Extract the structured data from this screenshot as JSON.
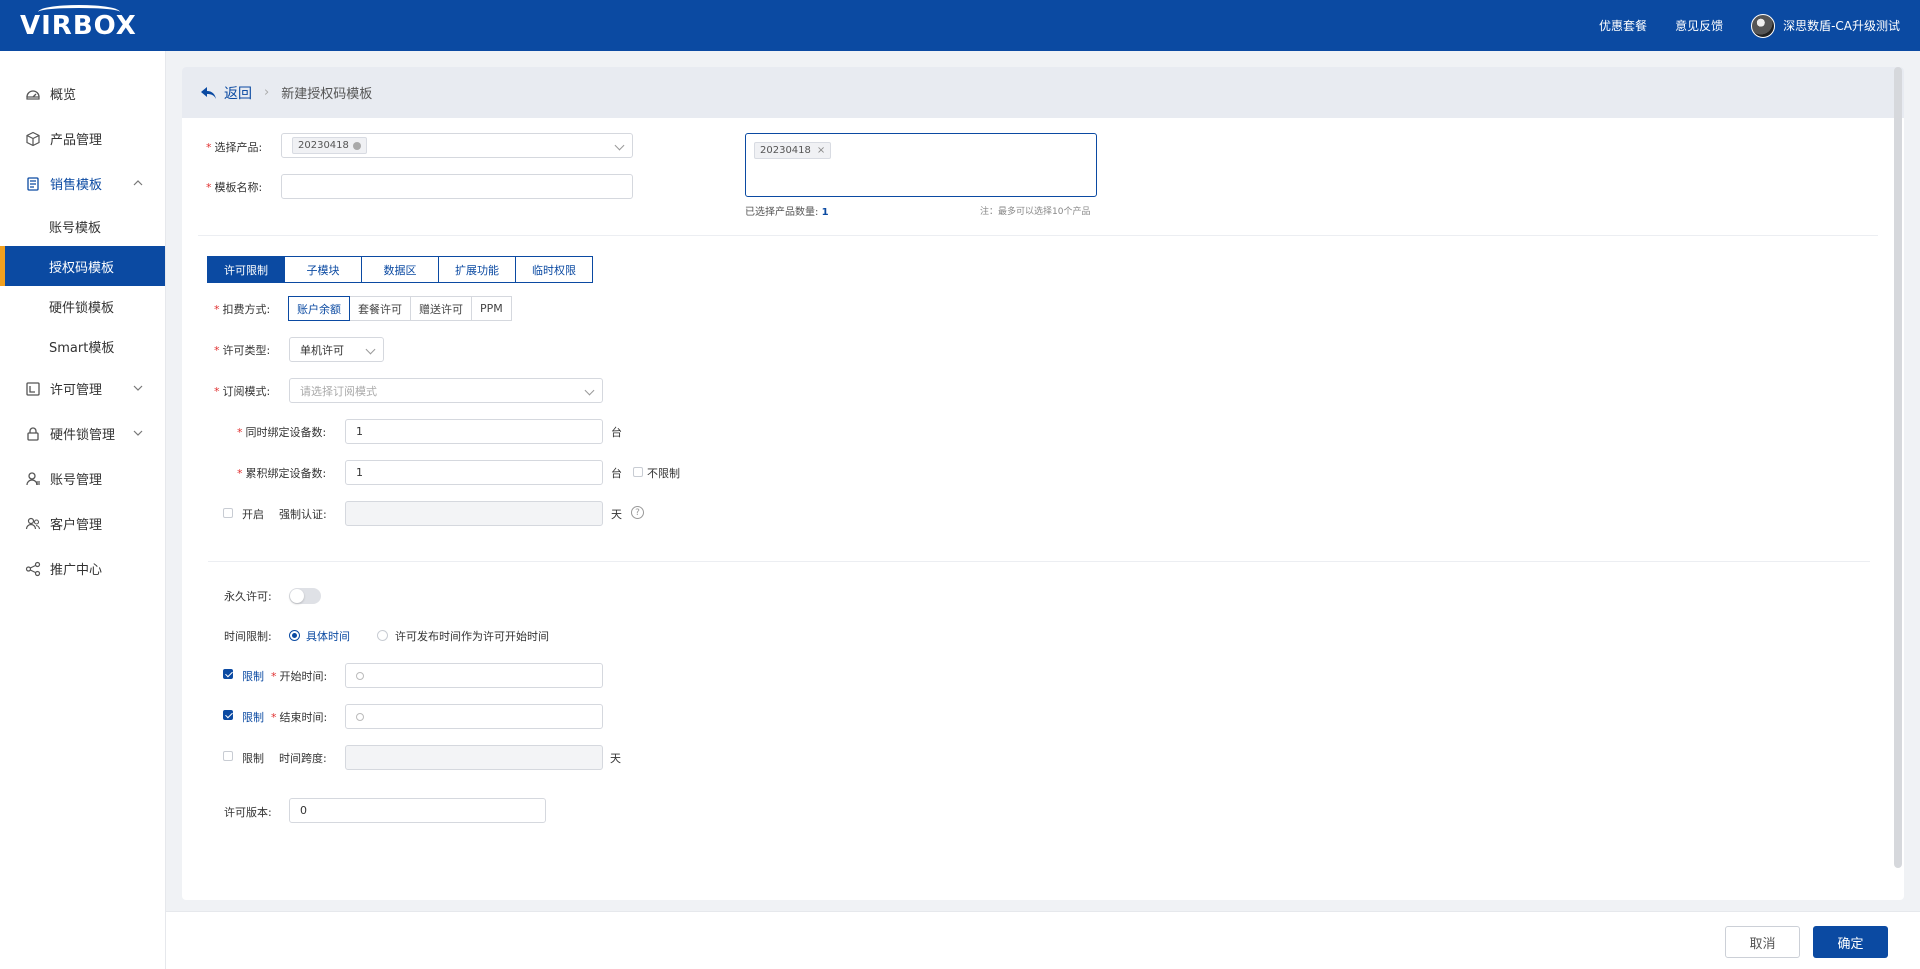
{
  "header": {
    "logo": "VIRBOX",
    "links": [
      "优惠套餐",
      "意见反馈"
    ],
    "user_name": "深思数盾-CA升级测试"
  },
  "sidebar": {
    "items": [
      {
        "label": "概览",
        "icon": "dashboard-icon"
      },
      {
        "label": "产品管理",
        "icon": "cube-icon"
      },
      {
        "label": "销售模板",
        "icon": "template-icon",
        "expanded": true,
        "children": [
          {
            "label": "账号模板"
          },
          {
            "label": "授权码模板",
            "active": true
          },
          {
            "label": "硬件锁模板"
          },
          {
            "label": "Smart模板"
          }
        ]
      },
      {
        "label": "许可管理",
        "icon": "license-icon"
      },
      {
        "label": "硬件锁管理",
        "icon": "lock-icon"
      },
      {
        "label": "账号管理",
        "icon": "user-icon"
      },
      {
        "label": "客户管理",
        "icon": "users-icon"
      },
      {
        "label": "推广中心",
        "icon": "share-icon"
      }
    ]
  },
  "breadcrumb": {
    "back": "返回",
    "current": "新建授权码模板"
  },
  "form": {
    "product_label": "选择产品:",
    "product_tag": "20230418",
    "template_name_label": "模板名称:",
    "template_name_value": "",
    "selected_tag": "20230418",
    "selected_count_label": "已选择产品数量:",
    "selected_count": "1",
    "note": "注：最多可以选择10个产品"
  },
  "tabs": [
    "许可限制",
    "子模块",
    "数据区",
    "扩展功能",
    "临时权限"
  ],
  "license": {
    "deduct_label": "扣费方式:",
    "deduct_options": [
      "账户余额",
      "套餐许可",
      "赠送许可",
      "PPM"
    ],
    "type_label": "许可类型:",
    "type_value": "单机许可",
    "subscribe_label": "订阅模式:",
    "subscribe_placeholder": "请选择订阅模式",
    "bind_devices_label": "同时绑定设备数:",
    "bind_devices_value": "1",
    "unit": "台",
    "total_devices_label": "累积绑定设备数:",
    "total_devices_value": "1",
    "unlimited_label": "不限制",
    "enable_label": "开启",
    "force_auth_label": "强制认证:",
    "day_unit": "天",
    "help_icon": "?",
    "permanent_label": "永久许可:",
    "time_limit_label": "时间限制:",
    "time_opt1": "具体时间",
    "time_opt2": "许可发布时间作为许可开始时间",
    "limit_label": "限制",
    "start_label": "开始时间:",
    "end_label": "结束时间:",
    "span_label": "时间跨度:",
    "version_label": "许可版本:",
    "version_value": "0"
  },
  "footer": {
    "cancel": "取消",
    "confirm": "确定"
  },
  "colors": {
    "primary": "#0b4aa2",
    "accent": "#f0a020"
  }
}
